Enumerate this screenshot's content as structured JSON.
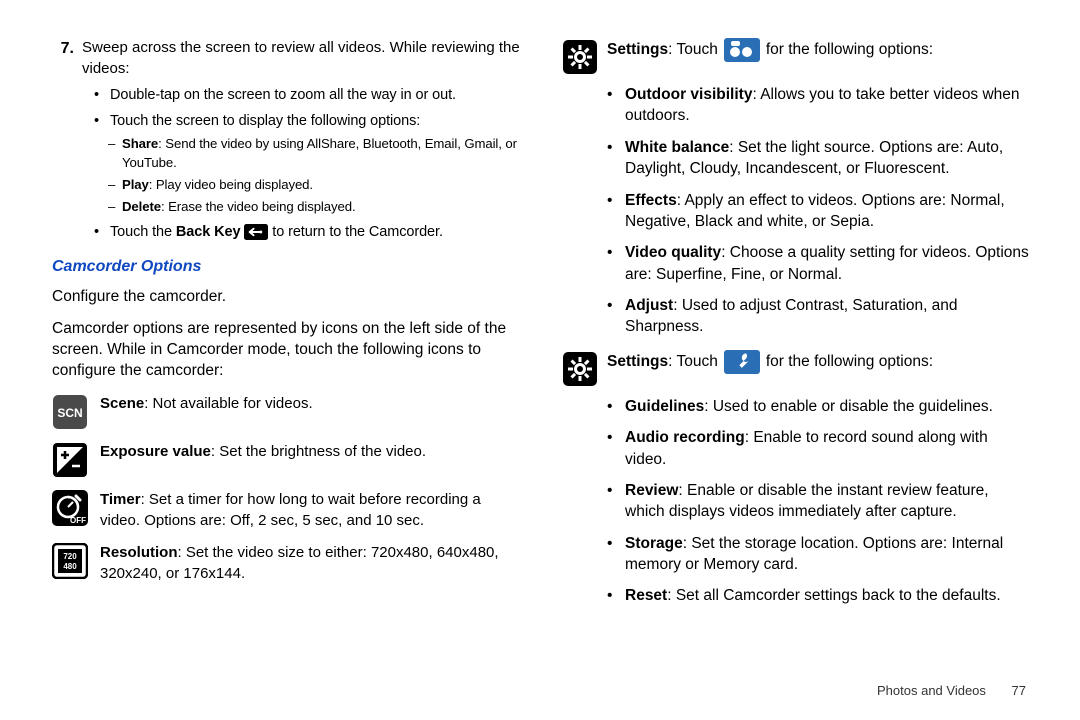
{
  "left": {
    "step_num": "7.",
    "step_text": "Sweep across the screen to review all videos. While reviewing the videos:",
    "sub1a": "Double-tap on the screen to zoom all the way in or out.",
    "sub1b": "Touch the screen to display the following options:",
    "d1_label": "Share",
    "d1_rest": ": Send the video by using AllShare, Bluetooth, Email, Gmail, or YouTube.",
    "d2_label": "Play",
    "d2_rest": ": Play video being displayed.",
    "d3_label": "Delete",
    "d3_rest": ": Erase the video being displayed.",
    "sub1c_pre": "Touch the ",
    "sub1c_bold": "Back Key",
    "sub1c_post": " to return to the Camcorder.",
    "heading": "Camcorder Options",
    "para1": "Configure the camcorder.",
    "para2": "Camcorder options are represented by icons on the left side of the screen. While in Camcorder mode, touch the following icons to configure the camcorder:",
    "opt1_label": "Scene",
    "opt1_rest": ": Not available for videos.",
    "opt2_label": "Exposure value",
    "opt2_rest": ": Set the brightness of the video.",
    "opt3_label": "Timer",
    "opt3_rest": ": Set a timer for how long to wait before recording a video. Options are: Off, 2 sec, 5 sec, and 10 sec.",
    "opt4_label": "Resolution",
    "opt4_rest": ": Set the video size to either: 720x480, 640x480, 320x240, or 176x144."
  },
  "right": {
    "s1_label": "Settings",
    "s1_pre": ": Touch ",
    "s1_post": " for the following options:",
    "b1_label": "Outdoor visibility",
    "b1_rest": ": Allows you to take better videos when outdoors.",
    "b2_label": "White balance",
    "b2_rest": ": Set the light source. Options are: Auto, Daylight, Cloudy, Incandescent, or Fluorescent.",
    "b3_label": "Effects",
    "b3_rest": ": Apply an effect to videos. Options are: Normal, Negative, Black and white, or Sepia.",
    "b4_label": "Video quality",
    "b4_rest": ": Choose a quality setting for videos. Options are: Superfine, Fine, or Normal.",
    "b5_label": "Adjust",
    "b5_rest": ": Used to adjust Contrast, Saturation, and Sharpness.",
    "s2_label": "Settings",
    "s2_pre": ": Touch ",
    "s2_post": " for the following options:",
    "c1_label": "Guidelines",
    "c1_rest": ": Used to enable or disable the guidelines.",
    "c2_label": "Audio recording",
    "c2_rest": ": Enable to record sound along with video.",
    "c3_label": "Review",
    "c3_rest": ": Enable or disable the instant review feature, which displays videos immediately after capture.",
    "c4_label": "Storage",
    "c4_rest": ": Set the storage location. Options are: Internal memory or Memory card.",
    "c5_label": "Reset",
    "c5_rest": ": Set all Camcorder settings back to the defaults."
  },
  "footer": {
    "section": "Photos and Videos",
    "page": "77"
  }
}
